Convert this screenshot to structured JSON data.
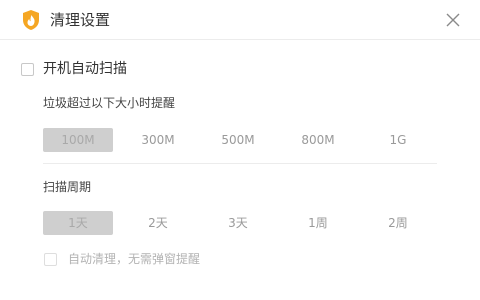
{
  "window": {
    "title": "清理设置",
    "icon": "flame-shield-icon",
    "close_icon": "close-icon",
    "accent": "#f5a623"
  },
  "settings": {
    "auto_scan": {
      "label": "开机自动扫描",
      "checked": false
    },
    "size_threshold": {
      "label": "垃圾超过以下大小时提醒",
      "options": [
        "100M",
        "300M",
        "500M",
        "800M",
        "1G"
      ],
      "selected": "100M"
    },
    "scan_period": {
      "label": "扫描周期",
      "options": [
        "1天",
        "2天",
        "3天",
        "1周",
        "2周"
      ],
      "selected": "1天"
    },
    "auto_clean": {
      "label": "自动清理，无需弹窗提醒",
      "checked": false,
      "disabled": true
    }
  }
}
